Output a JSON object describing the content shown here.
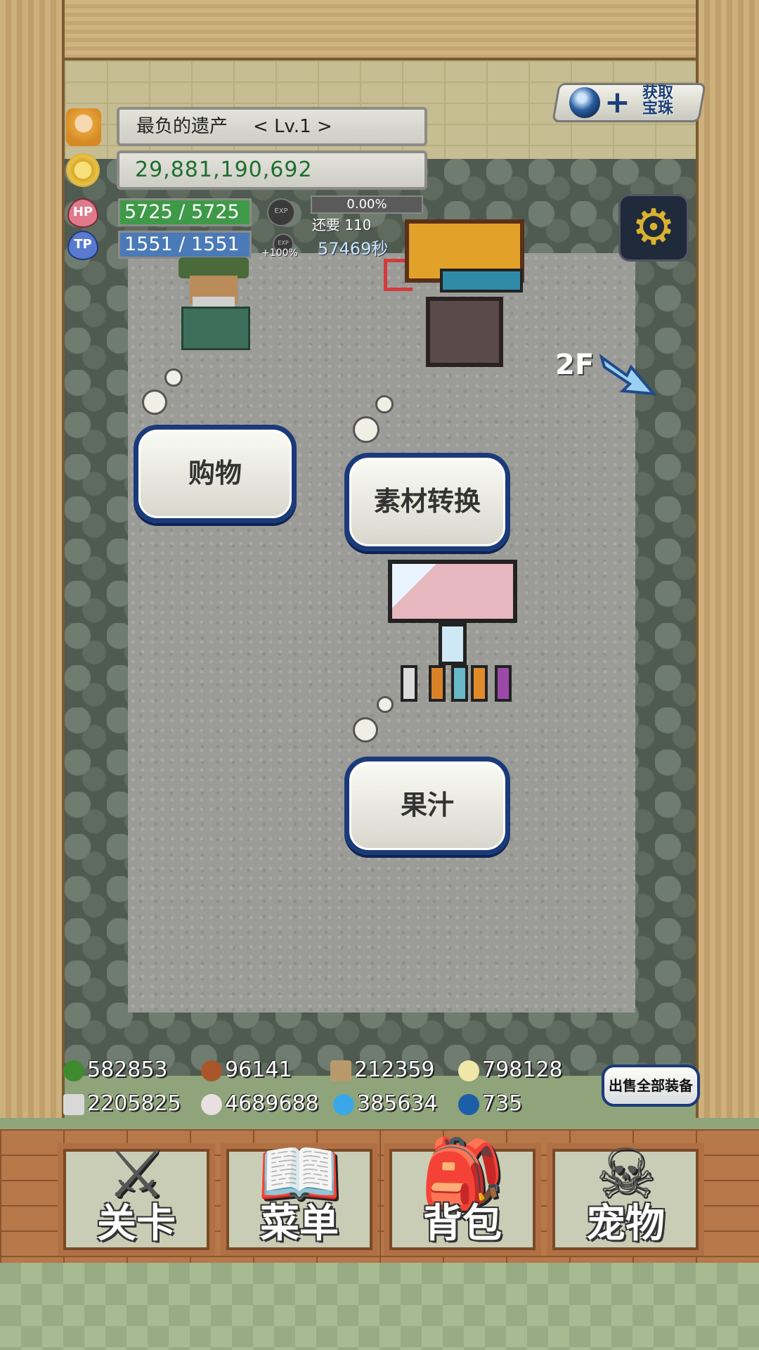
{
  "header": {
    "player_name": "最负的遗产",
    "level": "< Lv.1 >",
    "gold": "29,881,190,692",
    "hp_label": "HP",
    "hp": "5725 / 5725",
    "tp_label": "TP",
    "tp": "1551 / 1551",
    "exp_icon": "EXP",
    "exp_percent": "0.00%",
    "exp_remaining": "还要 110",
    "exp_bonus": "+100%",
    "timer": "57469秒"
  },
  "treasure_button": {
    "label": "获取宝珠"
  },
  "floor_label": "2F",
  "actions": {
    "shop": "购物",
    "material_convert": "素材转换",
    "juice": "果汁"
  },
  "resources": [
    {
      "icon": "herb-icon",
      "value": "582853"
    },
    {
      "icon": "wood-log-icon",
      "value": "96141"
    },
    {
      "icon": "plank-icon",
      "value": "212359"
    },
    {
      "icon": "drop-icon",
      "value": "798128"
    },
    {
      "icon": "iron-ingot-icon",
      "value": "2205825"
    },
    {
      "icon": "stone-icon",
      "value": "4689688"
    },
    {
      "icon": "blue-flame-icon",
      "value": "385634"
    },
    {
      "icon": "blue-orb-icon",
      "value": "735"
    }
  ],
  "sell_all_button": "出售全部装备",
  "bottom_nav": [
    {
      "label": "关卡",
      "icon": "crossed-swords-icon"
    },
    {
      "label": "菜单",
      "icon": "book-icon"
    },
    {
      "label": "背包",
      "icon": "backpack-icon"
    },
    {
      "label": "宠物",
      "icon": "dragon-skull-icon"
    }
  ],
  "colors": {
    "button_border": "#1b3a7a",
    "hp_bar": "#3e9a48",
    "tp_bar": "#4a7ab8",
    "gold_text": "#1e6e2e"
  }
}
